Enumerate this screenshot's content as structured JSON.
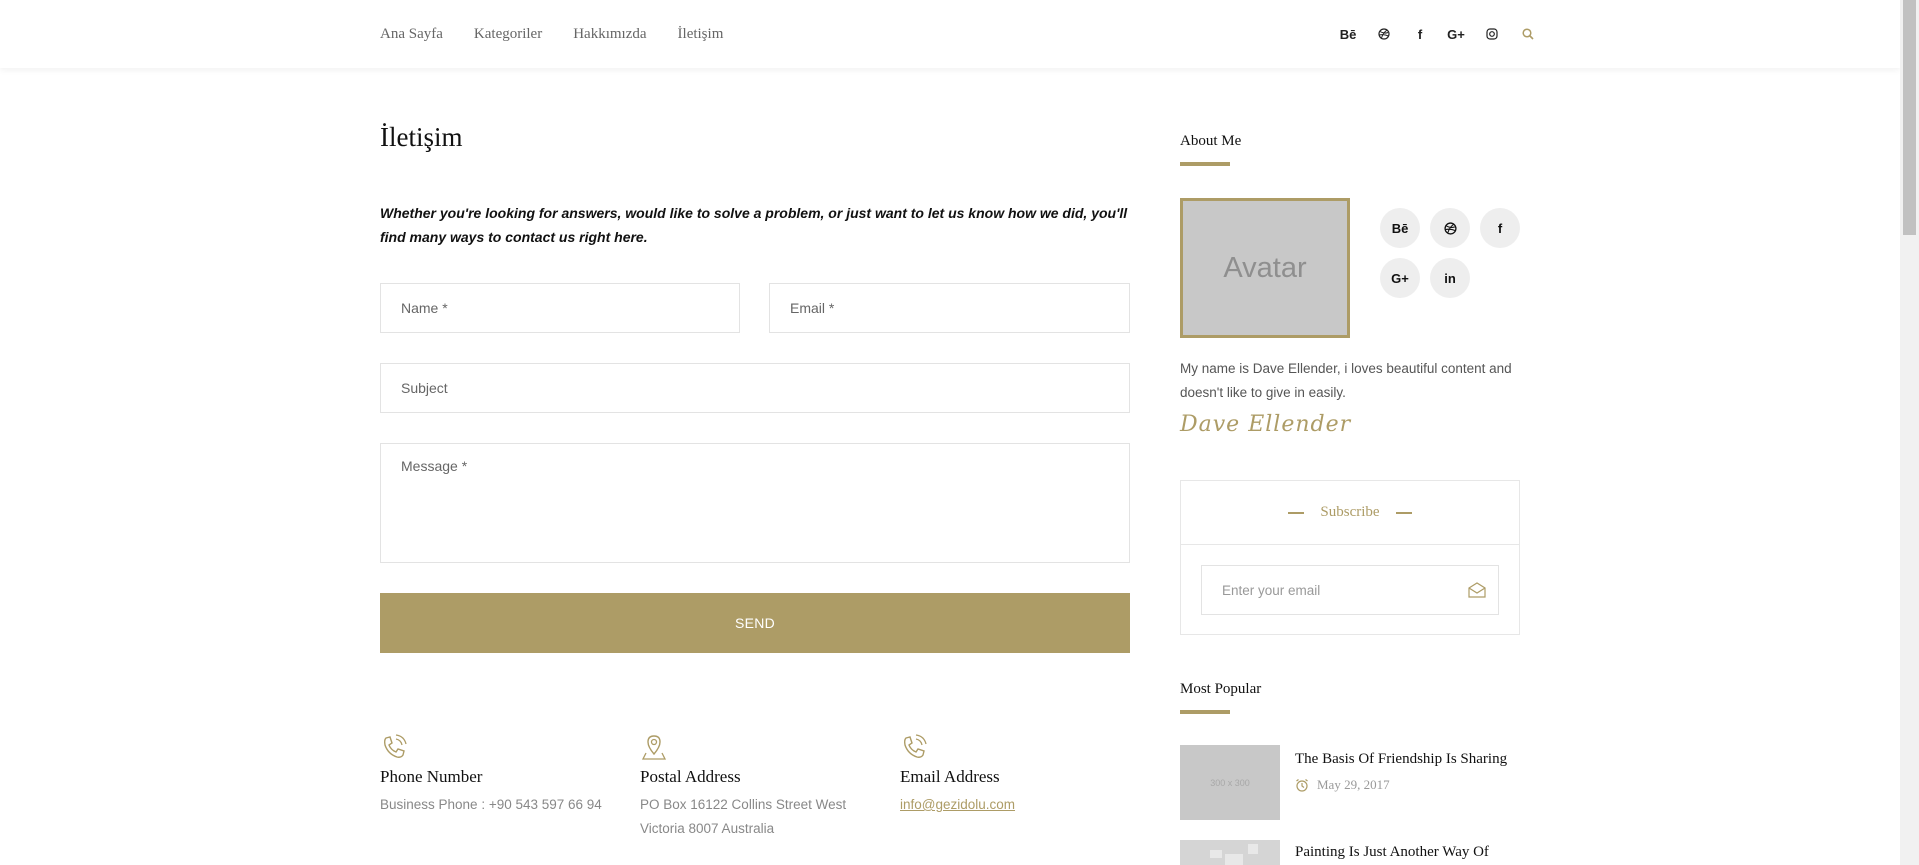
{
  "nav": {
    "items": [
      "Ana Sayfa",
      "Kategoriler",
      "Hakkımızda",
      "İletişim"
    ],
    "social": [
      "Bē",
      "⚽",
      "f",
      "G+",
      "◎",
      "🔍"
    ]
  },
  "main": {
    "title": "İletişim",
    "intro": "Whether you're looking for answers, would like to solve a problem, or just want to let us know how we did, you'll find many ways to contact us right here.",
    "form": {
      "name_placeholder": "Name *",
      "email_placeholder": "Email *",
      "subject_placeholder": "Subject",
      "message_placeholder": "Message *",
      "send_label": "SEND"
    },
    "contacts": [
      {
        "title": "Phone Number",
        "lines": [
          "Business Phone : +90 543 597 66 94"
        ]
      },
      {
        "title": "Postal Address",
        "lines": [
          "PO Box 16122 Collins Street West",
          "Victoria 8007 Australia"
        ]
      },
      {
        "title": "Email Address",
        "lines": [
          "info@gezidolu.com"
        ]
      }
    ]
  },
  "sidebar": {
    "about": {
      "title": "About Me",
      "avatar_label": "Avatar",
      "text": "My name is Dave Ellender, i loves beautiful content and doesn't like to give in easily.",
      "signature": "Dave Ellender",
      "social": [
        "Bē",
        "⚽",
        "f",
        "G+",
        "in"
      ]
    },
    "subscribe": {
      "title": "Subscribe",
      "placeholder": "Enter your email"
    },
    "popular": {
      "title": "Most Popular",
      "items": [
        {
          "thumb": "300 x 300",
          "title": "The Basis Of Friendship Is Sharing",
          "date": "May 29, 2017"
        },
        {
          "thumb": "",
          "title": "Painting Is Just Another Way Of",
          "date": ""
        }
      ]
    }
  },
  "colors": {
    "accent": "#ad9c66",
    "text": "#222222",
    "muted": "#888888"
  }
}
